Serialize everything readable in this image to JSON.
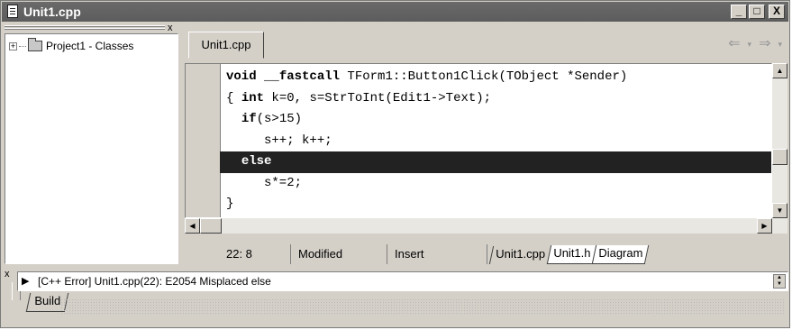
{
  "window": {
    "title": "Unit1.cpp",
    "minimize": "_",
    "maximize": "□",
    "close": "X"
  },
  "class_explorer": {
    "close": "x",
    "item": "Project1 - Classes"
  },
  "editor": {
    "tab": "Unit1.cpp",
    "nav": {
      "back": "⇐",
      "forward": "⇒",
      "dropdown": "▾"
    },
    "code": [
      {
        "text": "void __fastcall TForm1::Button1Click(TObject *Sender)",
        "highlighted": false
      },
      {
        "text": "{ int k=0, s=StrToInt(Edit1->Text);",
        "highlighted": false
      },
      {
        "text": "  if(s>15)",
        "highlighted": false
      },
      {
        "text": "     s++; k++;",
        "highlighted": false
      },
      {
        "text": "  else",
        "highlighted": true
      },
      {
        "text": "     s*=2;",
        "highlighted": false
      },
      {
        "text": "}",
        "highlighted": false
      }
    ]
  },
  "status": {
    "position": "22:  8",
    "modified": "Modified",
    "mode": "Insert",
    "file_tabs": [
      "Unit1.cpp",
      "Unit1.h",
      "Diagram"
    ]
  },
  "messages": {
    "close": "x",
    "text": "[C++ Error] Unit1.cpp(22): E2054 Misplaced else",
    "tab": "Build"
  }
}
